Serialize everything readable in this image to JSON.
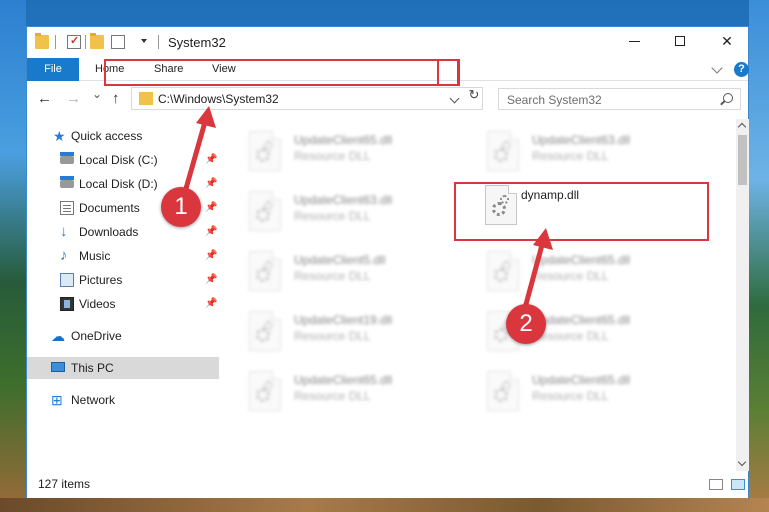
{
  "window": {
    "title": "System32",
    "controls": {
      "minimize": "",
      "maximize": "",
      "close": "✕"
    }
  },
  "ribbon": {
    "file_tab": "File",
    "tabs": [
      "Home",
      "Share",
      "View"
    ],
    "help": "?"
  },
  "navigation": {
    "back": "←",
    "forward": "→",
    "recent": "⌄",
    "up": "↑",
    "address": "C:\\Windows\\System32",
    "refresh": "↻",
    "search_placeholder": "Search System32"
  },
  "sidebar": {
    "quick_access": "Quick access",
    "items": [
      {
        "label": "Local Disk (C:)",
        "icon": "drive-icon",
        "pinned": true
      },
      {
        "label": "Local Disk (D:)",
        "icon": "drive-icon",
        "pinned": true
      },
      {
        "label": "Documents",
        "icon": "documents-icon",
        "pinned": true
      },
      {
        "label": "Downloads",
        "icon": "downloads-icon",
        "pinned": true
      },
      {
        "label": "Music",
        "icon": "music-icon",
        "pinned": true
      },
      {
        "label": "Pictures",
        "icon": "pictures-icon",
        "pinned": true
      },
      {
        "label": "Videos",
        "icon": "videos-icon",
        "pinned": true
      }
    ],
    "onedrive": "OneDrive",
    "this_pc": "This PC",
    "network": "Network",
    "pin_glyph": "📌"
  },
  "files": [
    {
      "name": "UpdateClient65.dll",
      "type": "Resource DLL",
      "blurred": true
    },
    {
      "name": "UpdateClient63.dll",
      "type": "Resource DLL",
      "blurred": true
    },
    {
      "name": "UpdateClient63.dll",
      "type": "Resource DLL",
      "blurred": true
    },
    {
      "name": "dynamp.dll",
      "type": "",
      "blurred": false
    },
    {
      "name": "UpdateClient5.dll",
      "type": "Resource DLL",
      "blurred": true
    },
    {
      "name": "UpdateClient65.dll",
      "type": "Resource DLL",
      "blurred": true
    },
    {
      "name": "UpdateClient19.dll",
      "type": "Resource DLL",
      "blurred": true
    },
    {
      "name": "UpdateClient65.dll",
      "type": "Resource DLL",
      "blurred": true
    },
    {
      "name": "UpdateClient65.dll",
      "type": "Resource DLL",
      "blurred": true
    },
    {
      "name": "UpdateClient65.dll",
      "type": "Resource DLL",
      "blurred": true
    }
  ],
  "status": {
    "item_count": "127 items"
  },
  "callouts": [
    {
      "number": "1",
      "target": "address bar"
    },
    {
      "number": "2",
      "target": "dynamp.dll"
    }
  ],
  "colors": {
    "accent": "#1979ca",
    "highlight": "#d9363e"
  }
}
